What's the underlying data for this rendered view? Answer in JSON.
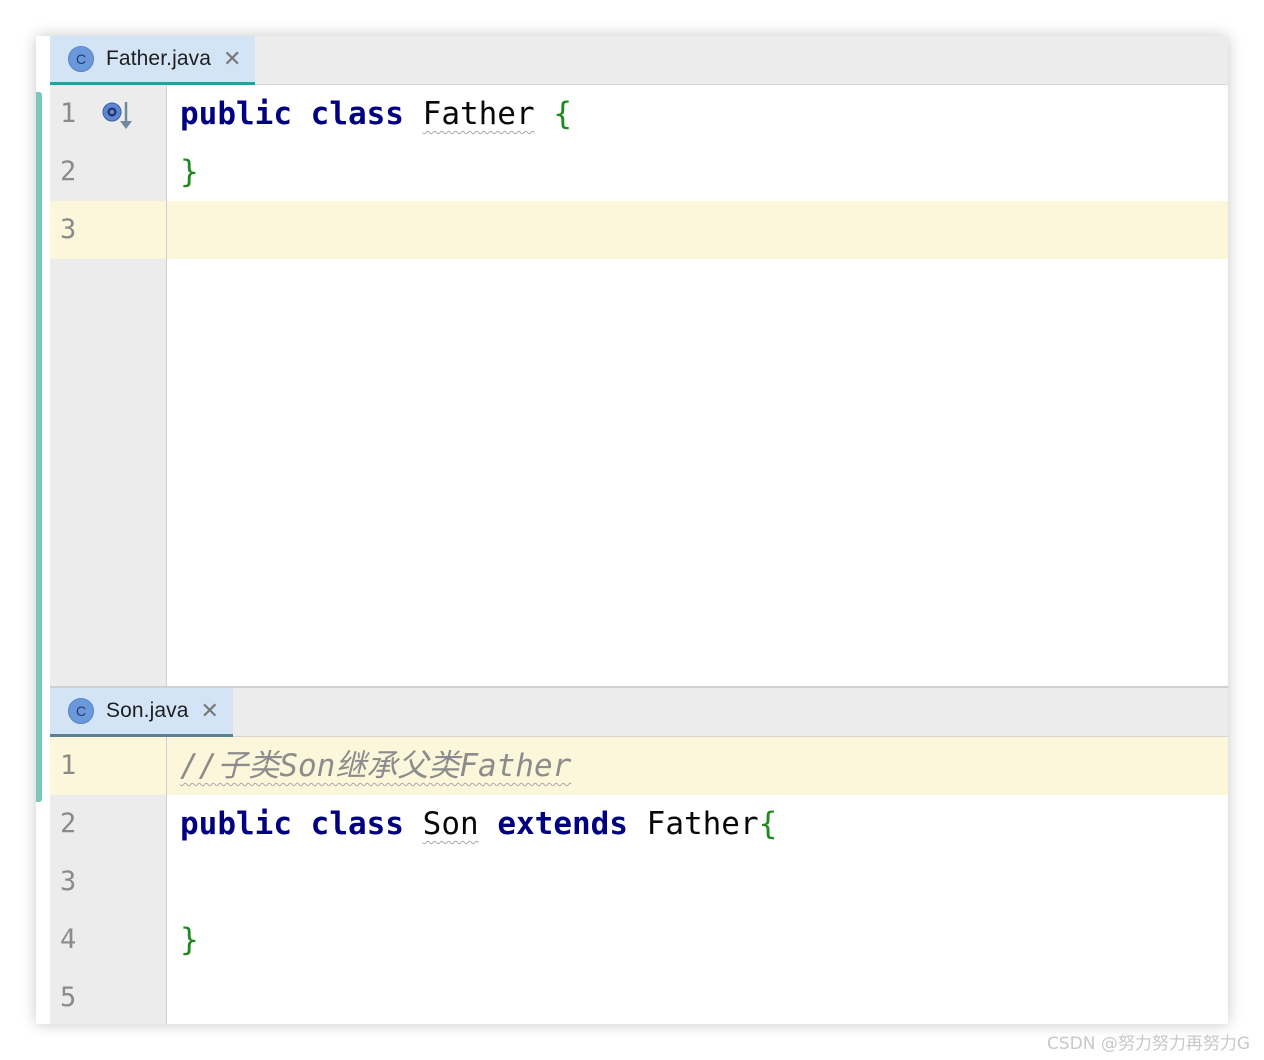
{
  "top_pane": {
    "tab": {
      "icon": "class-icon",
      "icon_letter": "C",
      "label": "Father.java",
      "close_icon": "close-icon"
    },
    "lines": [
      {
        "number": "1",
        "segments": [
          {
            "text": "public",
            "style": "kw"
          },
          {
            "text": " ",
            "style": ""
          },
          {
            "text": "class",
            "style": "kw"
          },
          {
            "text": " ",
            "style": ""
          },
          {
            "text": "Father",
            "style": "wavy"
          },
          {
            "text": " ",
            "style": ""
          },
          {
            "text": "{",
            "style": "brace"
          }
        ]
      },
      {
        "number": "2",
        "segments": [
          {
            "text": "}",
            "style": "brace"
          }
        ]
      },
      {
        "number": "3",
        "segments": []
      }
    ],
    "current_line": 3,
    "gutter_marker": "implemented-down-arrow-icon"
  },
  "bottom_pane": {
    "tab": {
      "icon": "class-icon",
      "icon_letter": "C",
      "label": "Son.java",
      "close_icon": "close-icon"
    },
    "lines": [
      {
        "number": "1",
        "segments": [
          {
            "text": "//子类Son继承父类Father",
            "style": "comment wavy"
          }
        ]
      },
      {
        "number": "2",
        "segments": [
          {
            "text": "public",
            "style": "kw"
          },
          {
            "text": " ",
            "style": ""
          },
          {
            "text": "class",
            "style": "kw"
          },
          {
            "text": " ",
            "style": ""
          },
          {
            "text": "Son",
            "style": "wavy"
          },
          {
            "text": " ",
            "style": ""
          },
          {
            "text": "extends",
            "style": "kw"
          },
          {
            "text": " ",
            "style": ""
          },
          {
            "text": "Father",
            "style": ""
          },
          {
            "text": "{",
            "style": "brace"
          }
        ]
      },
      {
        "number": "3",
        "segments": []
      },
      {
        "number": "4",
        "segments": [
          {
            "text": "}",
            "style": "brace"
          }
        ]
      },
      {
        "number": "5",
        "segments": []
      }
    ],
    "current_line": 1
  },
  "watermark": "CSDN @努力努力再努力G",
  "colors": {
    "keyword": "#000080",
    "brace": "#1e8a1e",
    "comment": "#8c8c8c",
    "current_line": "#fcf7da",
    "active_tab": "#d3e4f6",
    "tab_underline_top": "#2d9c9b",
    "tab_underline_bottom": "#5d7f92"
  }
}
